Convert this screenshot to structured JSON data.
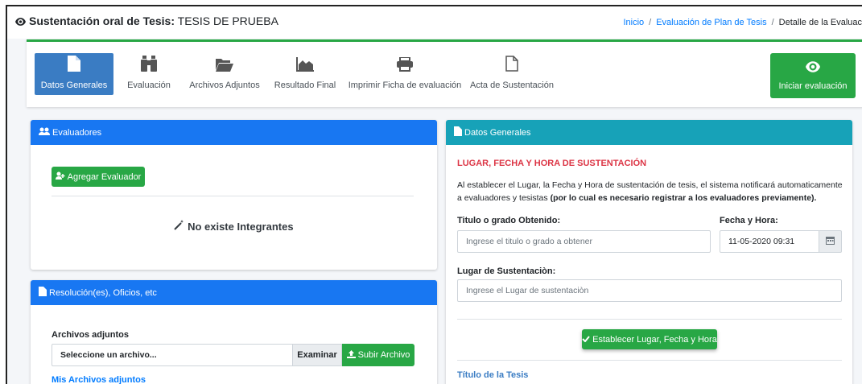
{
  "header": {
    "title_prefix": "Sustentación oral de Tesis:",
    "title_value": "TESIS DE PRUEBA",
    "breadcrumb": [
      "Inicio",
      "Evaluación de Plan de Tesis",
      "Detalle de la Evaluac"
    ]
  },
  "toolbar": {
    "items": [
      {
        "label": "Datos Generales",
        "icon": "file-icon"
      },
      {
        "label": "Evaluación",
        "icon": "binoculars-icon"
      },
      {
        "label": "Archivos Adjuntos",
        "icon": "folder-open-icon"
      },
      {
        "label": "Resultado Final",
        "icon": "area-chart-icon"
      },
      {
        "label": "Imprimir Ficha de evaluación",
        "icon": "print-icon"
      },
      {
        "label": "Acta de Sustentación",
        "icon": "file-outline-icon"
      }
    ],
    "start_label": "Iniciar evaluación"
  },
  "evaluadores": {
    "title": "Evaluadores",
    "add_button": "Agregar Evaluador",
    "empty_text": "No existe Integrantes"
  },
  "resoluciones": {
    "title": "Resolución(es), Oficios, etc",
    "files_label": "Archivos adjuntos",
    "file_placeholder": "Seleccione un archivo...",
    "browse_label": "Examinar",
    "upload_label": "Subir Archivo",
    "my_files_link": "Mis Archivos adjuntos"
  },
  "datos": {
    "title": "Datos Generales",
    "section_title": "LUGAR, FECHA Y HORA DE SUSTENTACIÓN",
    "info_text": "Al establecer el Lugar, la Fecha y Hora de sustentación de tesis, el sistema notificará automaticamente a evaluadores y tesistas",
    "info_bold": "(por lo cual es necesario registrar a los evaluadores previamente).",
    "grado_label": "Titulo o grado Obtenido:",
    "grado_placeholder": "Ingrese el titulo o grado a obtener",
    "fecha_label": "Fecha y Hora:",
    "fecha_value": "11-05-2020 09:31",
    "lugar_label": "Lugar de Sustentaciòn:",
    "lugar_placeholder": "Ingrese el Lugar de sustentaciòn",
    "submit_label": "Establecer Lugar, Fecha y Hora",
    "tesis_title_label": "Título de la Tesis"
  },
  "colors": {
    "primary": "#1877f2",
    "success": "#28a745",
    "info": "#17a2b8",
    "danger": "#dc3545",
    "active_tab": "#3a7cc3"
  }
}
